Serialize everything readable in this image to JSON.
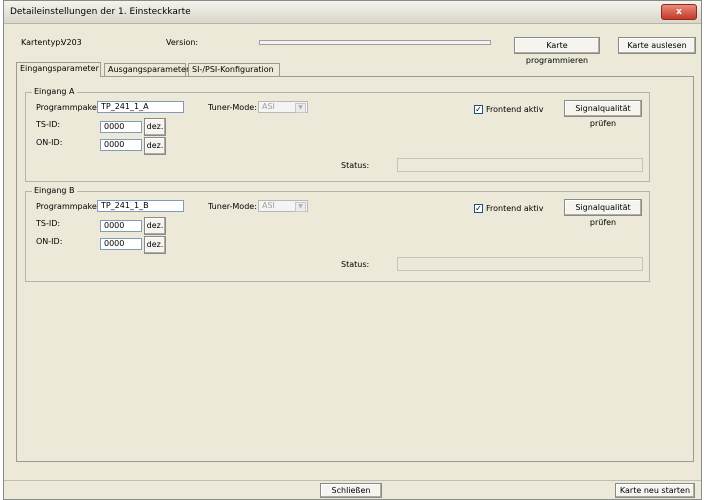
{
  "window": {
    "title": "Detaileinstellungen der 1. Einsteckkarte",
    "close_glyph": "x"
  },
  "header": {
    "cardtype_label": "Kartentyp:",
    "cardtype_value": "V203",
    "version_label": "Version:",
    "program_button": "Karte programmieren",
    "read_button": "Karte auslesen"
  },
  "tabs": [
    {
      "label": "Eingangsparameter"
    },
    {
      "label": "Ausgangsparameter"
    },
    {
      "label": "SI-/PSI-Konfiguration"
    }
  ],
  "inputs": [
    {
      "legend": "Eingang A",
      "package_label": "Programmpaket:",
      "package_value": "TP_241_1_A",
      "tuner_label": "Tuner-Mode:",
      "tuner_value": "ASI",
      "tsid_label": "TS-ID:",
      "tsid_value": "0000",
      "tsid_button": "dez.",
      "onid_label": "ON-ID:",
      "onid_value": "0000",
      "onid_button": "dez.",
      "frontend_label": "Frontend aktiv",
      "frontend_checked": "✓",
      "signal_button": "Signalqualität prüfen",
      "status_label": "Status:"
    },
    {
      "legend": "Eingang B",
      "package_label": "Programmpaket:",
      "package_value": "TP_241_1_B",
      "tuner_label": "Tuner-Mode:",
      "tuner_value": "ASI",
      "tsid_label": "TS-ID:",
      "tsid_value": "0000",
      "tsid_button": "dez.",
      "onid_label": "ON-ID:",
      "onid_value": "0000",
      "onid_button": "dez.",
      "frontend_label": "Frontend aktiv",
      "frontend_checked": "✓",
      "signal_button": "Signalqualität prüfen",
      "status_label": "Status:"
    }
  ],
  "footer": {
    "close_button": "Schließen",
    "restart_button": "Karte neu starten"
  }
}
